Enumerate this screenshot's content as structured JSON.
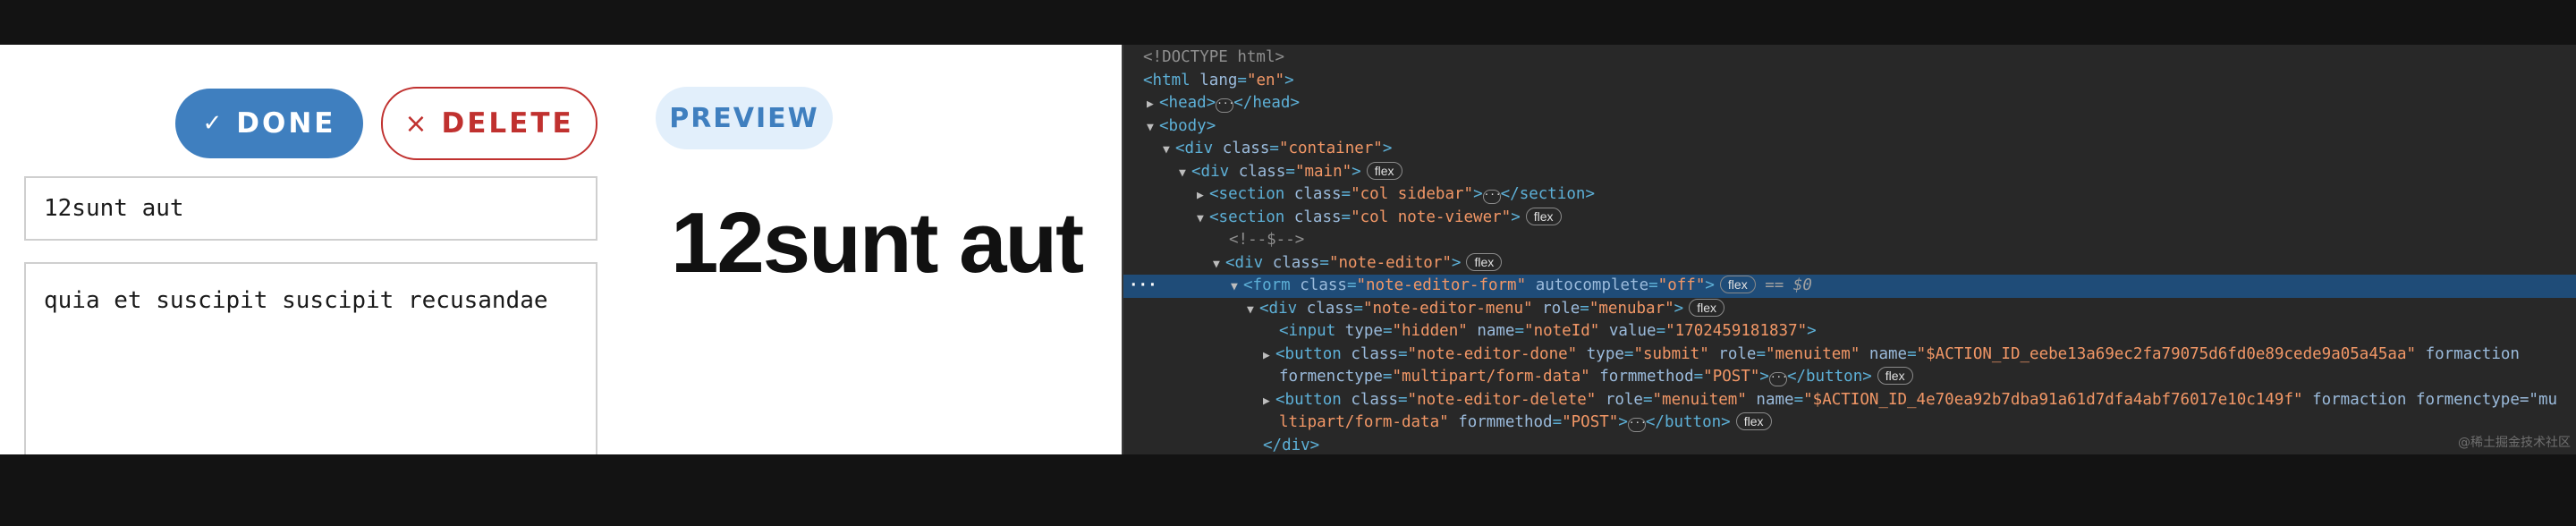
{
  "app": {
    "done_label": "DONE",
    "delete_label": "DELETE",
    "preview_label": "PREVIEW",
    "title_value": "12sunt aut",
    "body_value": "quia et suscipit suscipit recusandae",
    "preview_title": "12sunt aut",
    "icons": {
      "done": "check-icon",
      "delete": "x-icon"
    },
    "colors": {
      "primary": "#3f7fbf",
      "danger": "#c0312f",
      "preview_bg": "#e2effb"
    }
  },
  "devtools": {
    "doctype": "<!DOCTYPE html>",
    "html_tag": "html",
    "lang_attr": "lang",
    "lang_val": "\"en\"",
    "head_tag": "head",
    "body_tag": "body",
    "div": "div",
    "section": "section",
    "form": "form",
    "input": "input",
    "button": "button",
    "class_attr": "class",
    "container_val": "\"container\"",
    "main_val": "\"main\"",
    "sidebar_val": "\"col sidebar\"",
    "viewer_val": "\"col note-viewer\"",
    "comment": "<!--$-->",
    "editor_val": "\"note-editor\"",
    "form_val": "\"note-editor-form\"",
    "autocomplete_attr": "autocomplete",
    "autocomplete_val": "\"off\"",
    "eq_label": "== $0",
    "menu_val": "\"note-editor-menu\"",
    "role_attr": "role",
    "menubar_val": "\"menubar\"",
    "type_attr": "type",
    "hidden_val": "\"hidden\"",
    "name_attr": "name",
    "noteid_val": "\"noteId\"",
    "value_attr": "value",
    "value_val": "\"1702459181837\"",
    "done_class_val": "\"note-editor-done\"",
    "submit_val": "\"submit\"",
    "menuitem_val": "\"menuitem\"",
    "action_done_val": "\"$ACTION_ID_eebe13a69ec2fa79075d6fd0e89cede9a05a45aa\"",
    "formaction_attr": "formaction",
    "enctype_attr": "formenctype",
    "multipart_val": "\"multipart/form-data\"",
    "method_attr": "formmethod",
    "post_val": "\"POST\"",
    "delete_class_val": "\"note-editor-delete\"",
    "action_delete_val": "\"$ACTION_ID_4e70ea92b7dba91a61d7dfa4abf76017e10c149f\"",
    "enctype_split_a": "formenctype=\"mu",
    "enctype_split_b": "ltipart/form-data\"",
    "close_div": "</div>",
    "flex_badge": "flex",
    "ellipsis": "···",
    "selected_dots": "···",
    "watermark": "@稀土掘金技术社区"
  }
}
